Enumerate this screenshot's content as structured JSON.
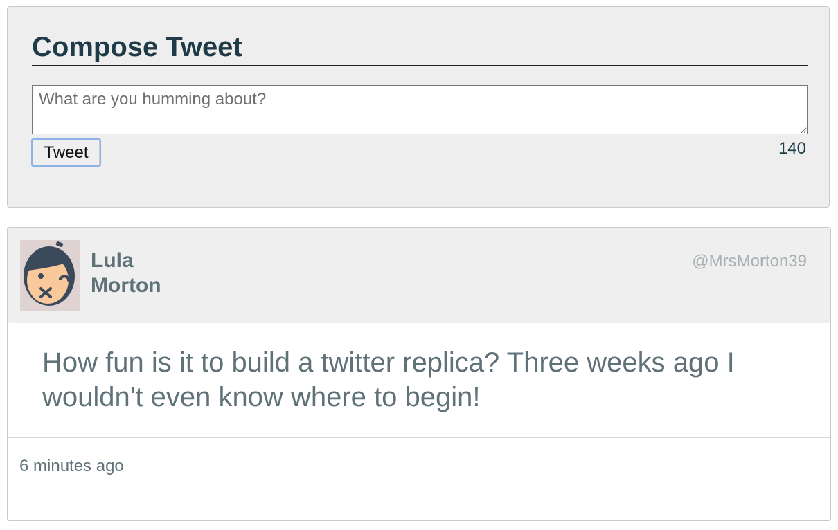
{
  "compose": {
    "title": "Compose Tweet",
    "placeholder": "What are you humming about?",
    "value": "",
    "button_label": "Tweet",
    "char_count": "140"
  },
  "tweet": {
    "first_name": "Lula",
    "last_name": "Morton",
    "handle": "@MrsMorton39",
    "body": "How fun is it to build a twitter replica? Three weeks ago I wouldn't even know where to begin!",
    "timestamp": "6 minutes ago",
    "avatar_icon": "smiling-face-avatar-icon"
  },
  "colors": {
    "page_background": "#ffffff",
    "panel_background": "#eeeeee",
    "title_color": "#1f3b47",
    "text_muted": "#5f7278",
    "handle_color": "#a8b0b3",
    "button_focus_border": "#8db3e8",
    "avatar_background": "#dfd2d3",
    "avatar_skin": "#f9c89b",
    "avatar_dark": "#3b4a5a"
  }
}
